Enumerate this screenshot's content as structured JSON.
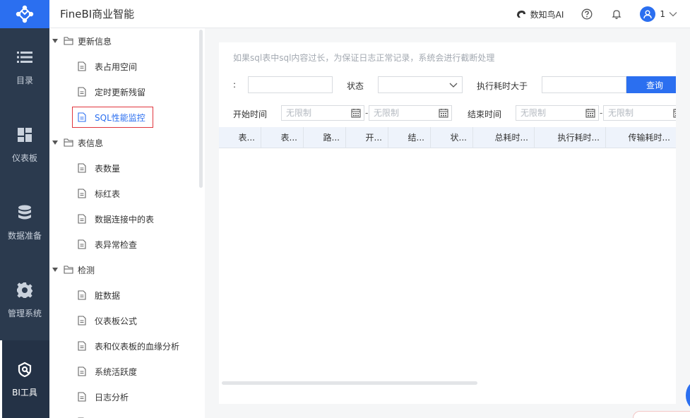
{
  "header": {
    "app_title": "FineBI商业智能",
    "ai_label": "数知鸟AI",
    "user_name": "1"
  },
  "rail": {
    "items": [
      {
        "label": "目录",
        "icon": "list-icon"
      },
      {
        "label": "仪表板",
        "icon": "dashboard-icon"
      },
      {
        "label": "数据准备",
        "icon": "database-icon"
      },
      {
        "label": "管理系统",
        "icon": "gear-icon"
      },
      {
        "label": "BI工具",
        "icon": "bi-tool-icon",
        "active": true
      }
    ]
  },
  "tree": {
    "groups": [
      {
        "label": "更新信息",
        "children": [
          "表占用空间",
          "定时更新残留",
          "SQL性能监控"
        ]
      },
      {
        "label": "表信息",
        "children": [
          "表数量",
          "标红表",
          "数据连接中的表",
          "表异常检查"
        ]
      },
      {
        "label": "检测",
        "children": [
          "脏数据",
          "仪表板公式",
          "表和仪表板的血缘分析",
          "系统活跃度",
          "日志分析"
        ]
      }
    ],
    "selected": "SQL性能监控"
  },
  "panel": {
    "hint": "如果sql表中sql内容过长，为保证日志正常记录，系统会进行截断处理",
    "colon_label": ":",
    "status_label": "状态",
    "exec_time_label": "执行耗时大于",
    "query_button": "查询",
    "start_time_label": "开始时间",
    "end_time_label": "结束时间",
    "date_placeholder": "无限制",
    "dash": "-",
    "columns": [
      "表...",
      "表...",
      "路...",
      "开...",
      "结...",
      "状...",
      "总耗时...",
      "执行耗时...",
      "传输耗时..."
    ]
  }
}
